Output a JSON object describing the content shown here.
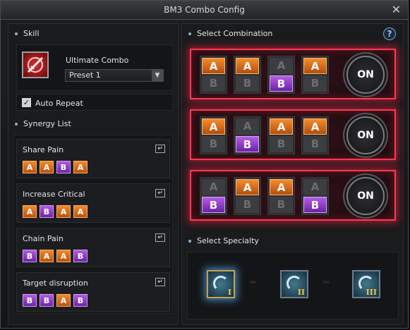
{
  "window": {
    "title": "BM3 Combo Config",
    "close_glyph": "✕"
  },
  "skill": {
    "section_title": "Skill",
    "name": "Ultimate Combo",
    "preset_value": "Preset 1",
    "dropdown_arrow": "▼",
    "auto_repeat_label": "Auto Repeat",
    "auto_repeat_checked": true,
    "check_glyph": "✓",
    "icon": "ultimate-combo-skill-icon"
  },
  "synergy": {
    "section_title": "Synergy List",
    "enter_glyph": "↵",
    "items": [
      {
        "name": "Share Pain",
        "chips": [
          "A",
          "A",
          "B",
          "A"
        ]
      },
      {
        "name": "Increase Critical",
        "chips": [
          "A",
          "B",
          "A",
          "A"
        ]
      },
      {
        "name": "Chain Pain",
        "chips": [
          "B",
          "A",
          "A",
          "B"
        ]
      },
      {
        "name": "Target disruption",
        "chips": [
          "B",
          "B",
          "A",
          "B"
        ]
      }
    ]
  },
  "combination": {
    "section_title": "Select Combination",
    "help_glyph": "?",
    "rows": [
      {
        "selected": [
          "A",
          "A",
          "B",
          "A"
        ],
        "toggle_label": "ON"
      },
      {
        "selected": [
          "A",
          "B",
          "A",
          "A"
        ],
        "toggle_label": "ON"
      },
      {
        "selected": [
          "B",
          "A",
          "A",
          "B"
        ],
        "toggle_label": "ON"
      }
    ],
    "labels": {
      "A": "A",
      "B": "B"
    }
  },
  "specialty": {
    "section_title": "Select Specialty",
    "items": [
      {
        "numeral": "I",
        "selected": true,
        "icon": "specialty-1-icon"
      },
      {
        "numeral": "II",
        "selected": false,
        "icon": "specialty-2-icon"
      },
      {
        "numeral": "III",
        "selected": false,
        "icon": "specialty-3-icon"
      }
    ],
    "chevron_glyph": "»»"
  },
  "colors": {
    "chip_a": "#e07020",
    "chip_b": "#9a3ed0",
    "combo_glow": "#ff3a56",
    "bullet": "#8ab0d8"
  }
}
